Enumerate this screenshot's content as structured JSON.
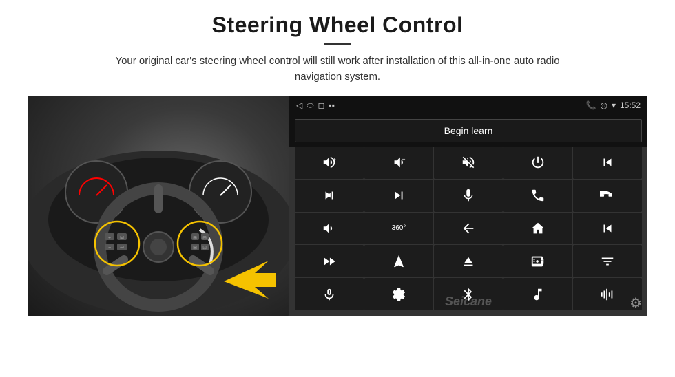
{
  "header": {
    "title": "Steering Wheel Control",
    "subtitle": "Your original car's steering wheel control will still work after installation of this all-in-one auto radio navigation system.",
    "divider": true
  },
  "statusbar": {
    "time": "15:52",
    "left_icons": [
      "back-icon",
      "home-icon",
      "recents-icon",
      "signal-icon"
    ],
    "right_icons": [
      "phone-icon",
      "location-icon",
      "wifi-icon"
    ]
  },
  "begin_learn_button": {
    "label": "Begin learn"
  },
  "controls": [
    {
      "icon": "vol-up",
      "symbol": "🔊+"
    },
    {
      "icon": "vol-down",
      "symbol": "🔉−"
    },
    {
      "icon": "vol-mute",
      "symbol": "🔇"
    },
    {
      "icon": "power",
      "symbol": "⏻"
    },
    {
      "icon": "prev-track",
      "symbol": "⏮"
    },
    {
      "icon": "next-track",
      "symbol": "⏭"
    },
    {
      "icon": "skip-fwd",
      "symbol": "⏩"
    },
    {
      "icon": "mic",
      "symbol": "🎤"
    },
    {
      "icon": "phone-call",
      "symbol": "📞"
    },
    {
      "icon": "phone-end",
      "symbol": "📵"
    },
    {
      "icon": "horn",
      "symbol": "📢"
    },
    {
      "icon": "360-cam",
      "symbol": "360"
    },
    {
      "icon": "back",
      "symbol": "↩"
    },
    {
      "icon": "home",
      "symbol": "🏠"
    },
    {
      "icon": "prev-chapter",
      "symbol": "⏮⏮"
    },
    {
      "icon": "next-chapter",
      "symbol": "⏭"
    },
    {
      "icon": "nav",
      "symbol": "▲"
    },
    {
      "icon": "eject",
      "symbol": "⏏"
    },
    {
      "icon": "radio",
      "symbol": "📻"
    },
    {
      "icon": "eq",
      "symbol": "🎚"
    },
    {
      "icon": "mic2",
      "symbol": "🎙"
    },
    {
      "icon": "settings2",
      "symbol": "⚙"
    },
    {
      "icon": "bluetooth",
      "symbol": "Ⓑ"
    },
    {
      "icon": "music",
      "symbol": "🎵"
    },
    {
      "icon": "equalizer",
      "symbol": "📶"
    }
  ],
  "watermark": "Seicane"
}
